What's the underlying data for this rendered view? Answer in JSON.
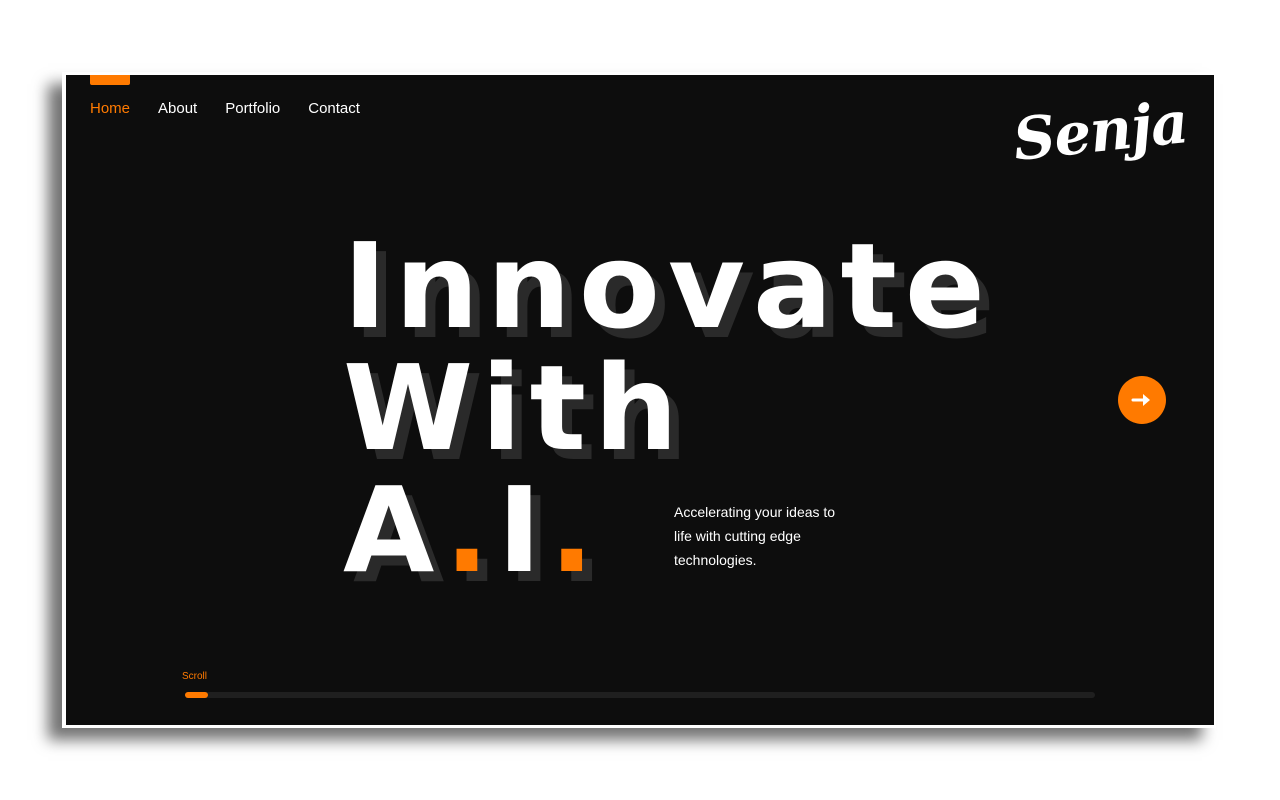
{
  "nav": {
    "items": [
      {
        "label": "Home",
        "active": true
      },
      {
        "label": "About",
        "active": false
      },
      {
        "label": "Portfolio",
        "active": false
      },
      {
        "label": "Contact",
        "active": false
      }
    ]
  },
  "brand": {
    "logo_text": "Senja"
  },
  "hero": {
    "line1": "Innovate",
    "line2": "With",
    "line3_a": "A",
    "line3_dot1": ".",
    "line3_i": "I",
    "line3_dot2": "."
  },
  "tagline": {
    "text": "Accelerating your ideas to life with cutting edge technologies."
  },
  "next_button": {
    "icon": "arrow-right-icon"
  },
  "scroll": {
    "label": "Scroll",
    "progress": 0.025
  },
  "colors": {
    "accent": "#ff7a00",
    "background": "#0d0d0d",
    "text": "#ffffff",
    "shadow_text": "#2a2a2a"
  }
}
